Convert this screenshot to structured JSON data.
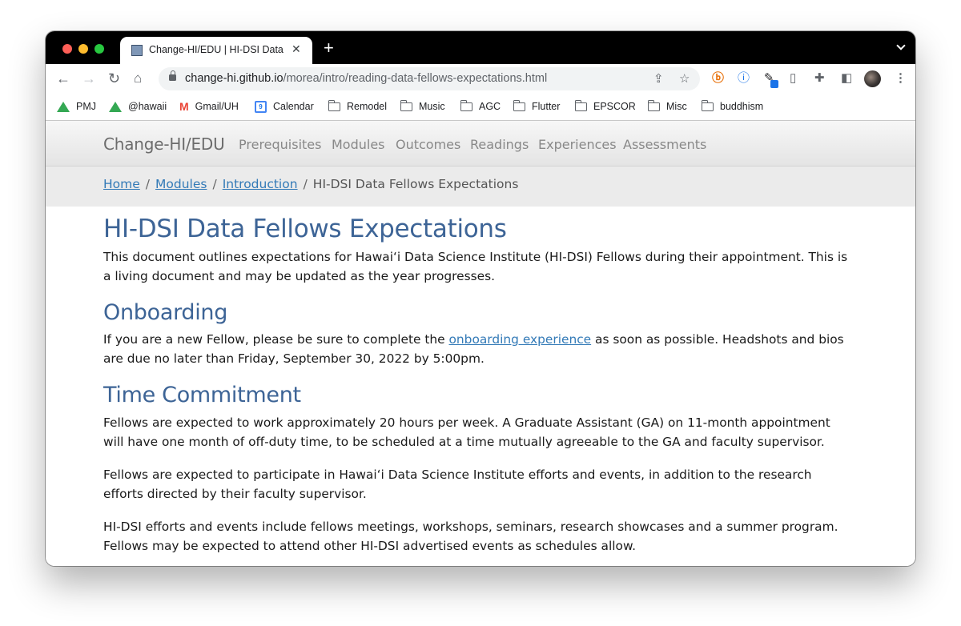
{
  "browser": {
    "tab": {
      "title": "Change-HI/EDU | HI-DSI Data Fellows Expectations"
    },
    "url": {
      "host": "change-hi.github.io",
      "path": "/morea/intro/reading-data-fellows-expectations.html"
    },
    "bookmarks": [
      {
        "label": "PMJ",
        "icon": "google-drive-icon"
      },
      {
        "label": "@hawaii",
        "icon": "google-drive-icon"
      },
      {
        "label": "Gmail/UH",
        "icon": "gmail-icon"
      },
      {
        "label": "Calendar",
        "icon": "calendar-icon",
        "badge": "9"
      },
      {
        "label": "Remodel",
        "icon": "folder-icon"
      },
      {
        "label": "Music",
        "icon": "folder-icon"
      },
      {
        "label": "AGC",
        "icon": "folder-icon"
      },
      {
        "label": "Flutter",
        "icon": "folder-icon"
      },
      {
        "label": "EPSCOR",
        "icon": "folder-icon"
      },
      {
        "label": "Misc",
        "icon": "folder-icon"
      },
      {
        "label": "buddhism",
        "icon": "folder-icon"
      }
    ]
  },
  "site": {
    "brand": "Change-HI/EDU",
    "nav": [
      "Prerequisites",
      "Modules",
      "Outcomes",
      "Readings",
      "Experiences",
      "Assessments"
    ]
  },
  "breadcrumb": {
    "items": [
      "Home",
      "Modules",
      "Introduction"
    ],
    "current": "HI-DSI Data Fellows Expectations"
  },
  "page": {
    "title": "HI-DSI Data Fellows Expectations",
    "intro": "This document outlines expectations for Hawaiʻi Data Science Institute (HI-DSI) Fellows during their appointment. This is a living document and may be updated as the year progresses.",
    "onboarding": {
      "heading": "Onboarding",
      "text_before": "If you are a new Fellow, please be sure to complete the ",
      "link": "onboarding experience",
      "text_after": " as soon as possible. Headshots and bios are due no later than Friday, September 30, 2022 by 5:00pm."
    },
    "time_commitment": {
      "heading": "Time Commitment",
      "paragraphs": [
        "Fellows are expected to work approximately 20 hours per week. A Graduate Assistant (GA) on 11-month appointment will have one month of off-duty time, to be scheduled at a time mutually agreeable to the GA and faculty supervisor.",
        "Fellows are expected to participate in Hawaiʻi Data Science Institute efforts and events, in addition to the research efforts directed by their faculty supervisor.",
        "HI-DSI efforts and events include fellows meetings, workshops, seminars, research showcases and a summer program. Fellows may be expected to attend other HI-DSI advertised events as schedules allow."
      ]
    }
  }
}
